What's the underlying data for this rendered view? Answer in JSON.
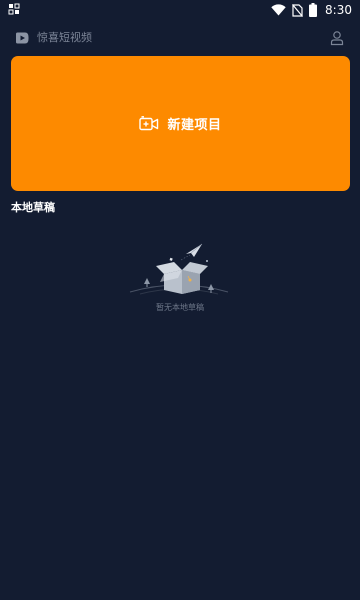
{
  "status_bar": {
    "time": "8:30",
    "icons": [
      "notification-icon",
      "wifi-icon",
      "no-sim-icon",
      "battery-icon"
    ]
  },
  "header": {
    "app_name": "惊喜短视频",
    "logo_icon": "play-logo-icon",
    "profile_icon": "user-icon"
  },
  "new_project": {
    "label": "新建项目",
    "icon": "video-camera-add-icon",
    "color": "#fd8a00"
  },
  "drafts": {
    "section_title": "本地草稿",
    "empty_message": "暂无本地草稿",
    "empty_icon": "empty-box-icon"
  },
  "colors": {
    "background": "#131c31",
    "accent": "#fd8a00",
    "muted_text": "#7c8597"
  }
}
